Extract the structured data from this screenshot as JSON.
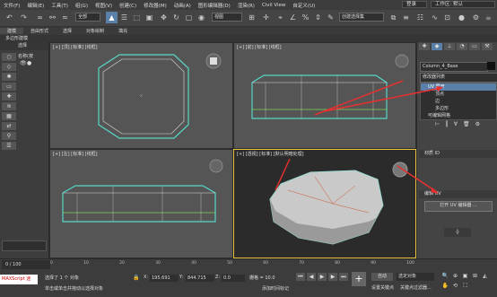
{
  "menu": [
    "文件(F)",
    "编辑(E)",
    "工具(T)",
    "组(G)",
    "视图(V)",
    "创建(C)",
    "修改器(M)",
    "动画(A)",
    "图形编辑器(D)",
    "渲染(R)",
    "Civil View",
    "自定义(U)"
  ],
  "top_right": {
    "user_label": "登录",
    "workspace_label": "工作区: 默认"
  },
  "toolbar": {
    "selection_filter": "全部",
    "view_dropdown": "视图",
    "named_sel": "创建选择集"
  },
  "ribbon": {
    "tabs": [
      "建模",
      "自由形式",
      "选择",
      "对象绘制",
      "填充"
    ]
  },
  "ribbon_sub": "多边形建模",
  "left": {
    "header": "选择",
    "item": "名称(按"
  },
  "viewports": {
    "top": "[+] [顶] [标准] [线框]",
    "front": "[+] [前] [标准] [线框]",
    "left": "[+] [左] [标准] [线框]",
    "persp": "[+] [透视] [标准] [默认明暗处理]"
  },
  "panel": {
    "object_name": "Column_4_Base",
    "modifier_list_label": "修改器列表",
    "stack": [
      "UV 展开",
      "顶点",
      "边",
      "多边形",
      "可编辑网格"
    ],
    "rollout_channel": "材质 ID",
    "rollout_uv": "编辑 UV",
    "open_uv_button": "打开 UV 编辑器 ..."
  },
  "status": {
    "timeline": "0 / 100",
    "ticks": [
      "0",
      "10",
      "20",
      "30",
      "40",
      "50",
      "60",
      "70",
      "80",
      "90",
      "100"
    ],
    "maxscript": "MAXScript 迷",
    "selected": "选择了 1 个 对象",
    "hint": "单击或单击并拖动以选择对象",
    "x_label": "X:",
    "x_val": "195.691",
    "y_label": "Y:",
    "y_val": "844.715",
    "z_label": "Z:",
    "z_val": "0.0",
    "grid": "栅格 = 10.0",
    "add_time_tag": "添加时间标记",
    "auto_key": "自动",
    "set_key": "设置关键点",
    "selected_obj": "选定对象",
    "key_filter": "关键点过滤器..."
  }
}
